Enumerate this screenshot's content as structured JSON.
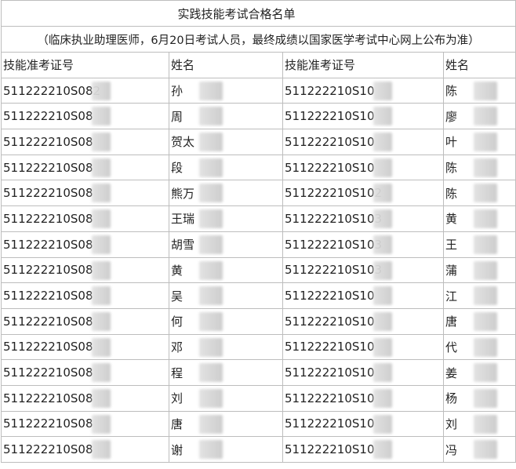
{
  "title": "实践技能考试合格名单",
  "subtitle": "（临床执业助理医师，6月20日考试人员，最终成绩以国家医学考试中心网上公布为准）",
  "columns": [
    "技能准考证号",
    "姓名",
    "技能准考证号",
    "姓名"
  ],
  "rows": [
    {
      "id_a": "511222210S082",
      "name_a": "孙",
      "id_b": "511222210S10",
      "name_b": "陈"
    },
    {
      "id_a": "511222210S08",
      "name_a": "周",
      "id_b": "511222210S10",
      "name_b": "廖"
    },
    {
      "id_a": "511222210S08",
      "name_a": "贺太",
      "id_b": "511222210S10",
      "name_b": "叶"
    },
    {
      "id_a": "511222210S08",
      "name_a": "段",
      "id_b": "511222210S10",
      "name_b": "陈"
    },
    {
      "id_a": "511222210S08",
      "name_a": "熊万",
      "id_b": "511222210S102",
      "name_b": "陈"
    },
    {
      "id_a": "511222210S08",
      "name_a": "王瑞",
      "id_b": "511222210S103",
      "name_b": "黄"
    },
    {
      "id_a": "511222210S08",
      "name_a": "胡雪",
      "id_b": "511222210S103",
      "name_b": "王"
    },
    {
      "id_a": "511222210S08",
      "name_a": "黄",
      "id_b": "511222210S103",
      "name_b": "蒲"
    },
    {
      "id_a": "511222210S08",
      "name_a": "吴",
      "id_b": "511222210S10",
      "name_b": "江"
    },
    {
      "id_a": "511222210S08",
      "name_a": "何",
      "id_b": "511222210S10",
      "name_b": "唐"
    },
    {
      "id_a": "511222210S08",
      "name_a": "邓",
      "id_b": "511222210S10",
      "name_b": "代"
    },
    {
      "id_a": "511222210S08",
      "name_a": "程",
      "id_b": "511222210S10",
      "name_b": "姜"
    },
    {
      "id_a": "511222210S08",
      "name_a": "刘",
      "id_b": "511222210S10",
      "name_b": "杨"
    },
    {
      "id_a": "511222210S08",
      "name_a": "唐",
      "id_b": "511222210S10",
      "name_b": "刘"
    },
    {
      "id_a": "511222210S08",
      "name_a": "谢",
      "id_b": "511222210S10",
      "name_b": "冯"
    }
  ]
}
